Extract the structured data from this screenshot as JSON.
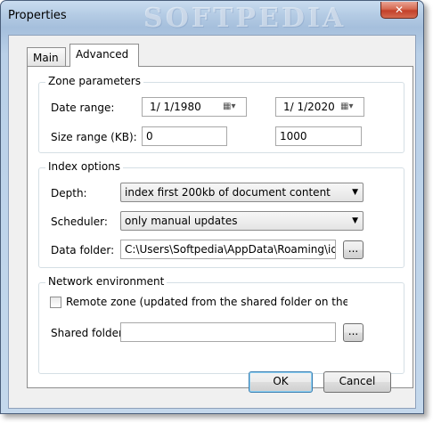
{
  "window": {
    "title": "Properties",
    "watermark": "SOFTPEDIA",
    "close_glyph": "✕"
  },
  "tabs": [
    {
      "label": "Main",
      "active": false
    },
    {
      "label": "Advanced",
      "active": true
    }
  ],
  "zone_parameters": {
    "title": "Zone parameters",
    "date_range_label": "Date range:",
    "date_from": "1/ 1/1980",
    "date_to": "1/ 1/2020",
    "size_range_label": "Size range (KB):",
    "size_from": "0",
    "size_to": "1000"
  },
  "index_options": {
    "title": "Index options",
    "depth_label": "Depth:",
    "depth_value": "index first 200kb of document content",
    "scheduler_label": "Scheduler:",
    "scheduler_value": "only manual updates",
    "data_folder_label": "Data folder:",
    "data_folder_value": "C:\\Users\\Softpedia\\AppData\\Roaming\\ids\\S",
    "browse_label": "..."
  },
  "network_environment": {
    "title": "Network environment",
    "remote_zone_label": "Remote zone (updated from the shared folder on the server)",
    "remote_zone_checked": false,
    "shared_folder_label": "Shared folder:",
    "shared_folder_value": "",
    "browse_label": "..."
  },
  "buttons": {
    "ok": "OK",
    "cancel": "Cancel"
  },
  "icons": {
    "calendar": "calendar-icon",
    "dropdown": "chevron-down-icon"
  }
}
